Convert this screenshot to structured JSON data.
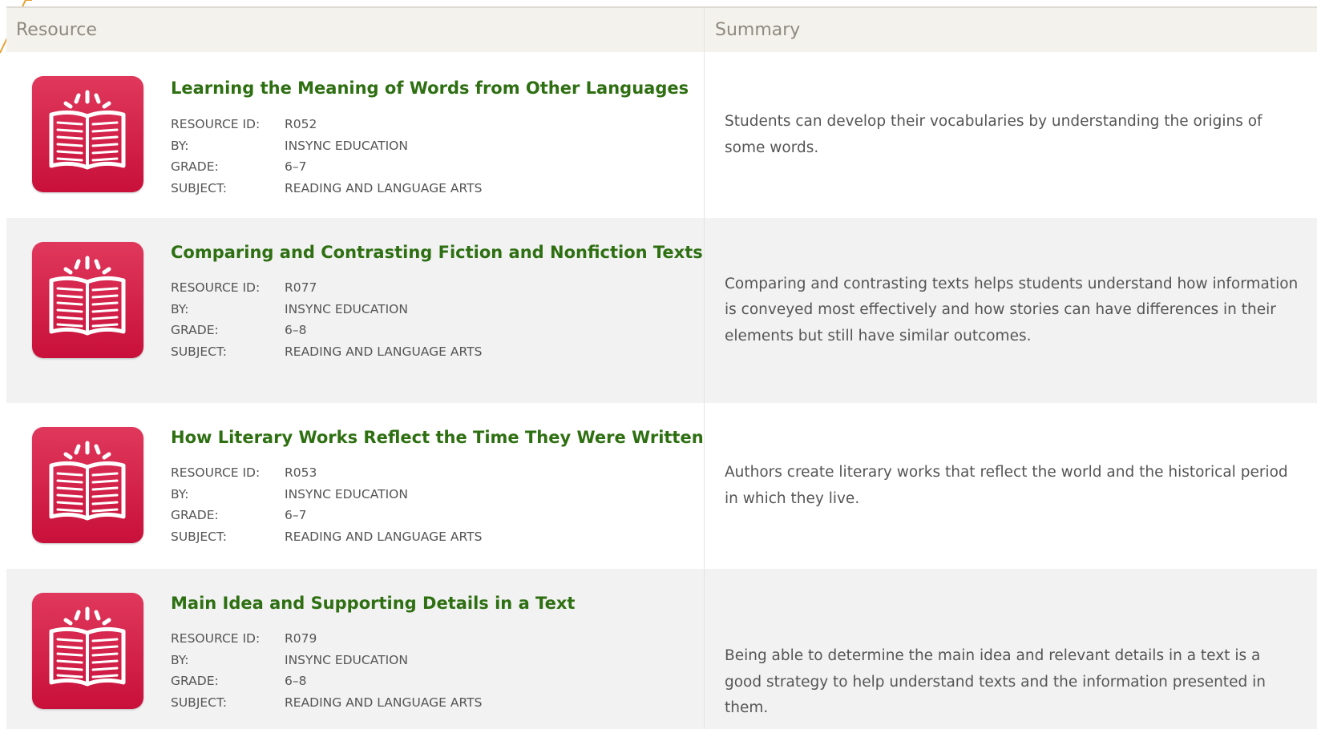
{
  "table": {
    "header": {
      "resource": "Resource",
      "summary": "Summary"
    },
    "field_labels": {
      "id": "RESOURCE ID:",
      "by": "BY:",
      "grade": "GRADE:",
      "subject": "SUBJECT:"
    },
    "rows": [
      {
        "title": "Learning the Meaning of Words from Other Languages",
        "id": "R052",
        "by": "INSYNC EDUCATION",
        "grade": "6–7",
        "subject": "READING AND LANGUAGE ARTS",
        "summary": "Students can develop their vocabularies by understanding the origins of some words."
      },
      {
        "title": "Comparing and Contrasting Fiction and Nonfiction Texts",
        "id": "R077",
        "by": "INSYNC EDUCATION",
        "grade": "6–8",
        "subject": "READING AND LANGUAGE ARTS",
        "summary": "Comparing and contrasting texts helps students understand how information is conveyed most effectively and how stories can have differences in their elements but still have similar outcomes."
      },
      {
        "title": "How Literary Works Reflect the Time They Were Written",
        "id": "R053",
        "by": "INSYNC EDUCATION",
        "grade": "6–7",
        "subject": "READING AND LANGUAGE ARTS",
        "summary": "Authors create literary works that reflect the world and the historical period in which they live."
      },
      {
        "title": "Main Idea and Supporting Details in a Text",
        "id": "R079",
        "by": "INSYNC EDUCATION",
        "grade": "6–8",
        "subject": "READING AND LANGUAGE ARTS",
        "summary": "Being able to determine the main idea and relevant details in a text is a good strategy to help understand texts and the information presented in them."
      }
    ]
  },
  "colors": {
    "title_link": "#2e6f12",
    "icon_tile": "#d4214b",
    "header_bg": "#f4f2ec",
    "alt_row_bg": "#f2f2f2",
    "annotation_line": "#e8a030"
  },
  "icons": {
    "resource_icon": "open-book-icon"
  }
}
